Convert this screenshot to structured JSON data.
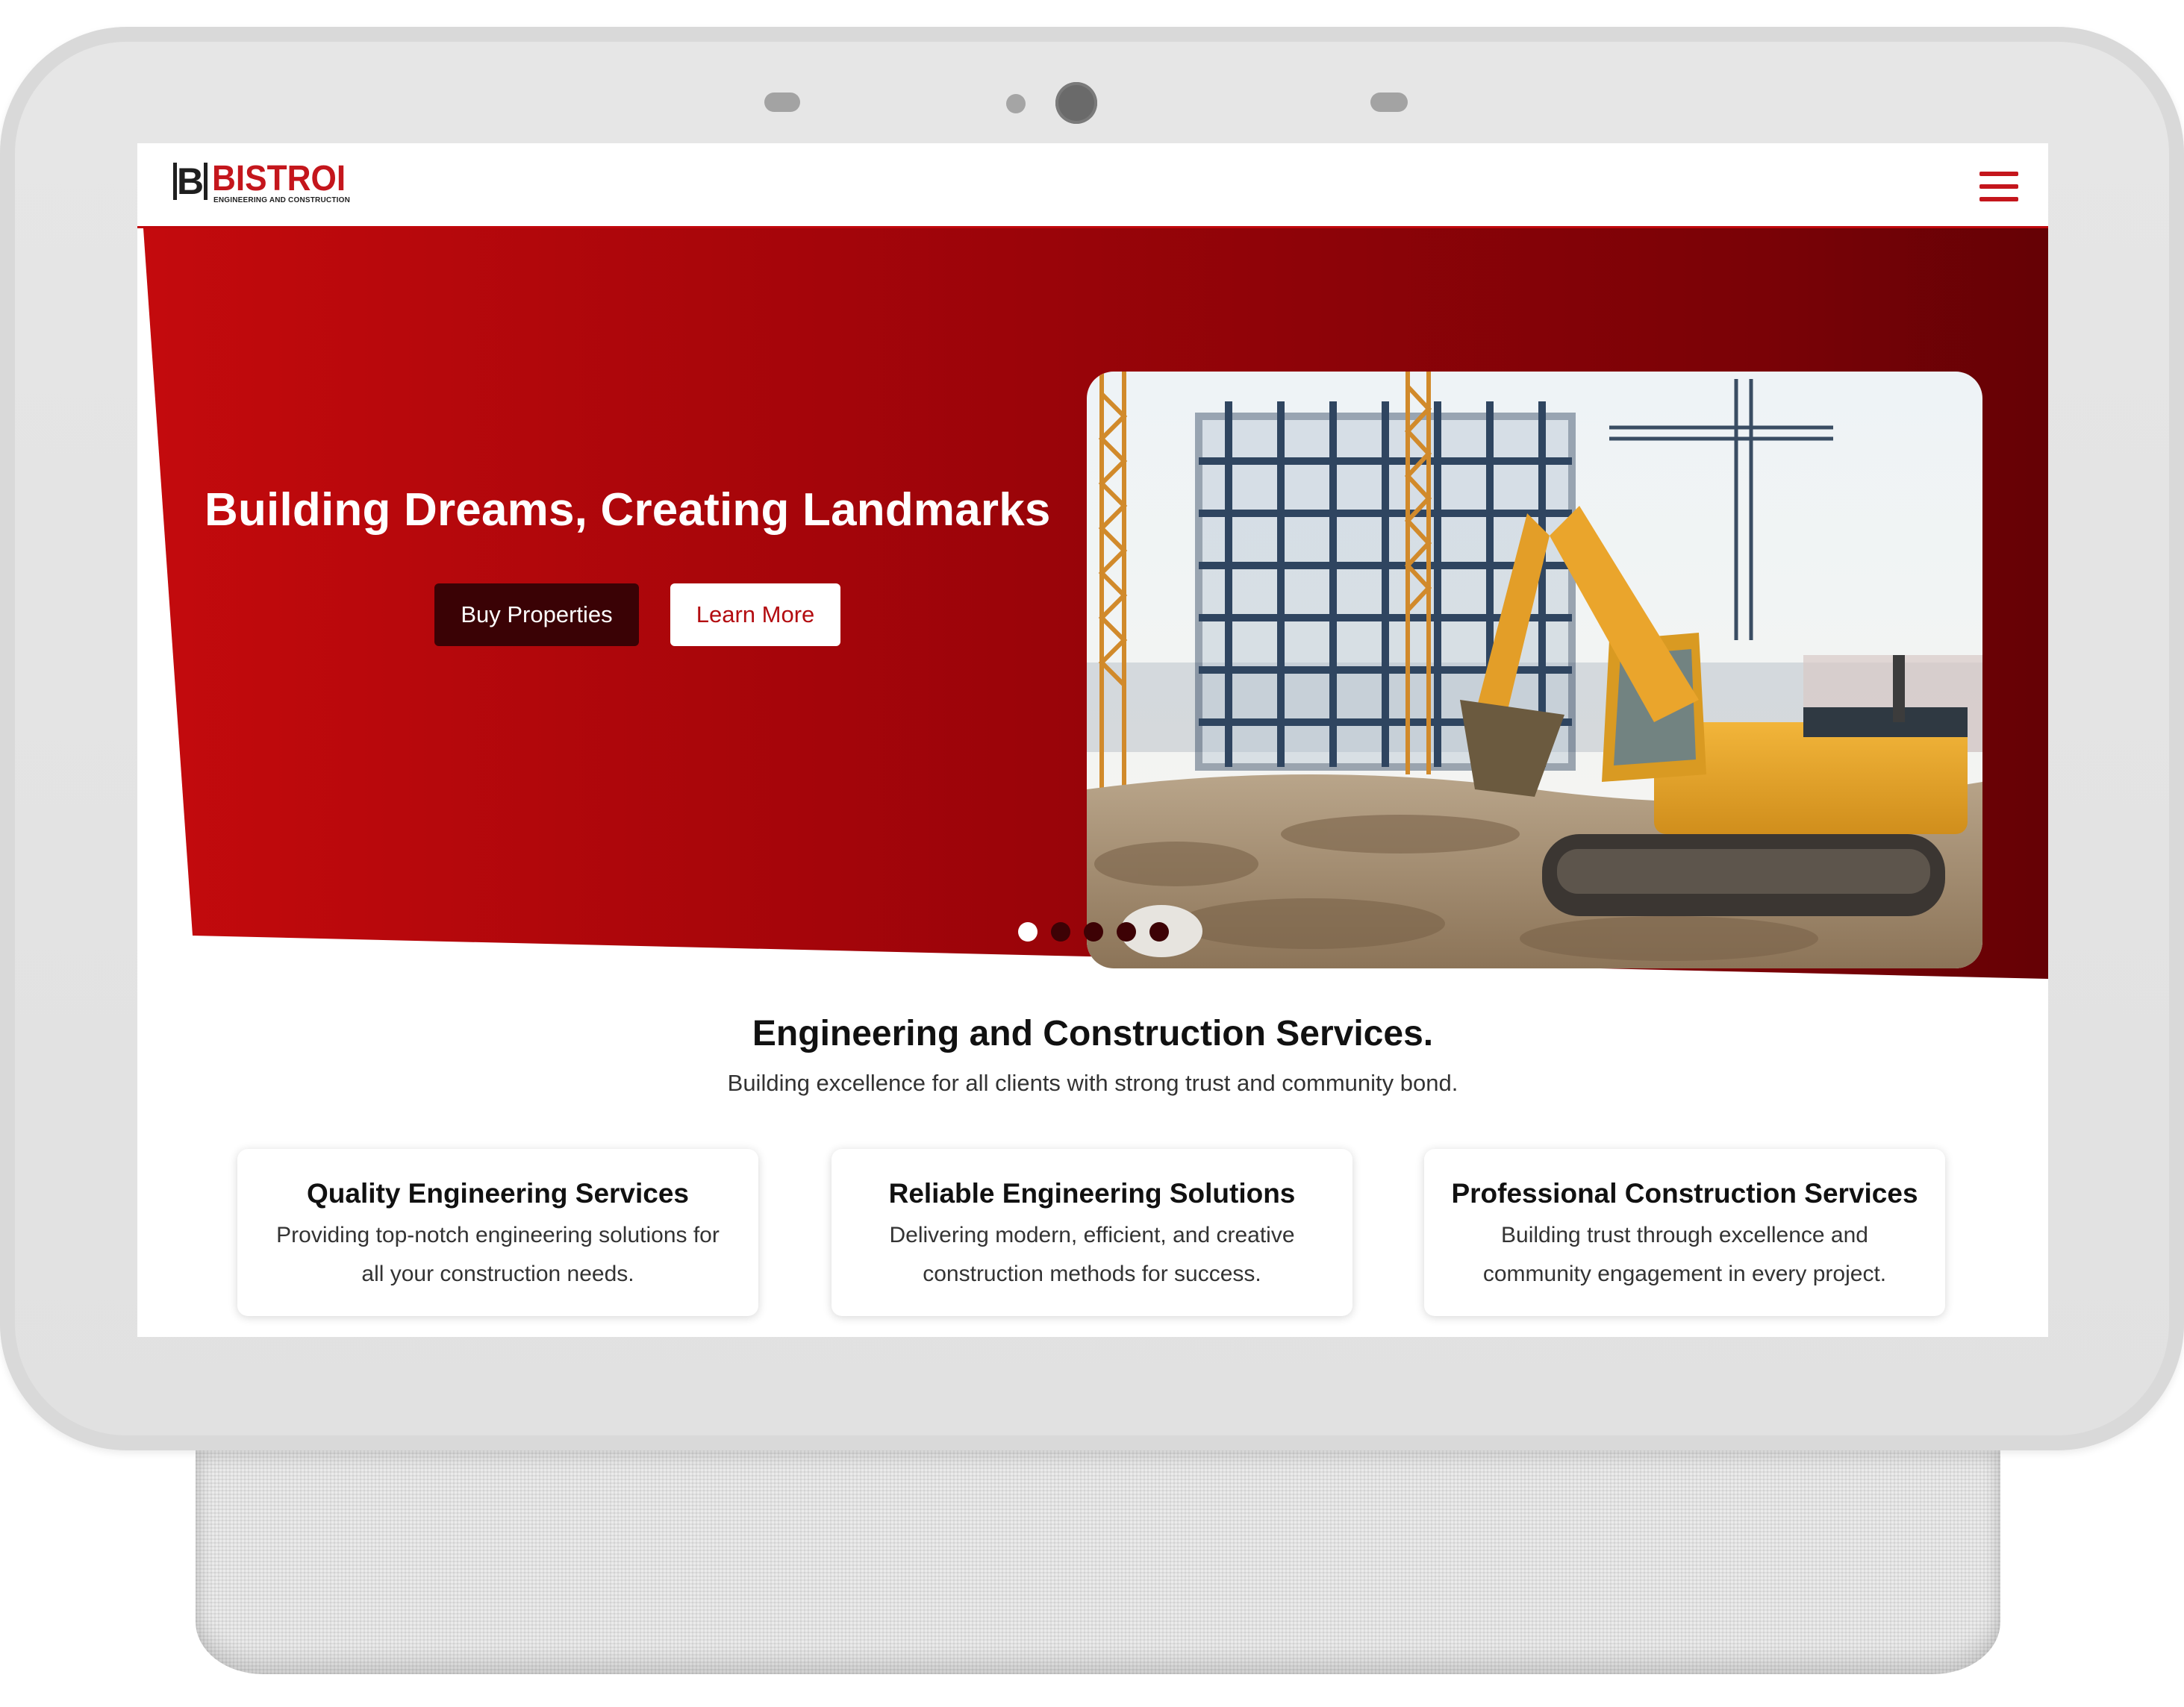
{
  "brand": {
    "logo_letter": "B",
    "name": "BISTROI",
    "tagline": "ENGINEERING AND CONSTRUCTION",
    "accent_color": "#c4161c",
    "dark_red": "#3a0205"
  },
  "nav": {
    "menu_icon": "hamburger-icon"
  },
  "hero": {
    "title": "Building Dreams, Creating Landmarks",
    "primary_button": "Buy Properties",
    "secondary_button": "Learn More",
    "image": "construction-site-excavator-photo",
    "carousel": {
      "slides": 5,
      "active_index": 0
    }
  },
  "services": {
    "heading": "Engineering and Construction Services.",
    "subheading": "Building excellence for all clients with strong trust and community bond.",
    "cards": [
      {
        "title": "Quality Engineering Services",
        "line1": "Providing top-notch engineering solutions for",
        "line2": "all your construction needs."
      },
      {
        "title": "Reliable Engineering Solutions",
        "line1": "Delivering modern, efficient, and creative",
        "line2": "construction methods for success."
      },
      {
        "title": "Professional Construction Services",
        "line1": "Building trust through excellence and",
        "line2": "community engagement in every project."
      }
    ]
  }
}
